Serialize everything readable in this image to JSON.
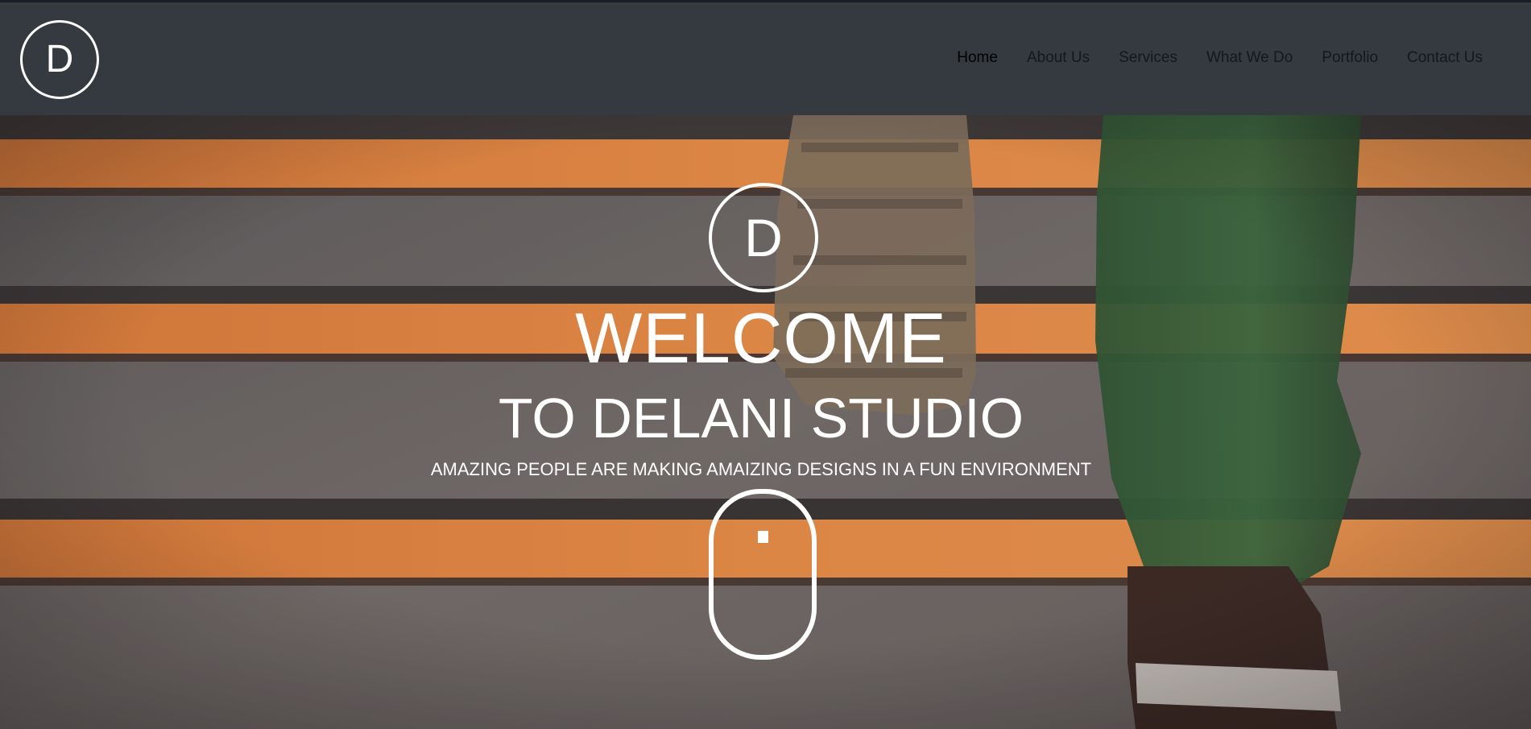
{
  "brand": {
    "logo_letter": "D"
  },
  "nav": {
    "items": [
      {
        "label": "Home",
        "active": true
      },
      {
        "label": "About Us",
        "active": false
      },
      {
        "label": "Services",
        "active": false
      },
      {
        "label": "What We Do",
        "active": false
      },
      {
        "label": "Portfolio",
        "active": false
      },
      {
        "label": "Contact Us",
        "active": false
      }
    ]
  },
  "hero": {
    "logo_letter": "D",
    "title": "WELCOME",
    "subtitle": "TO DELANI STUDIO",
    "tagline": "AMAZING PEOPLE ARE MAKING AMAIZING DESIGNS IN A FUN ENVIRONMENT",
    "scroll_icon": "mouse-scroll-icon",
    "background": "photo of a person walking up orange-striped concrete stairs"
  },
  "colors": {
    "navbar_bg": "#343a40",
    "stair_stripe": "#f08d3c",
    "text": "#ffffff"
  }
}
